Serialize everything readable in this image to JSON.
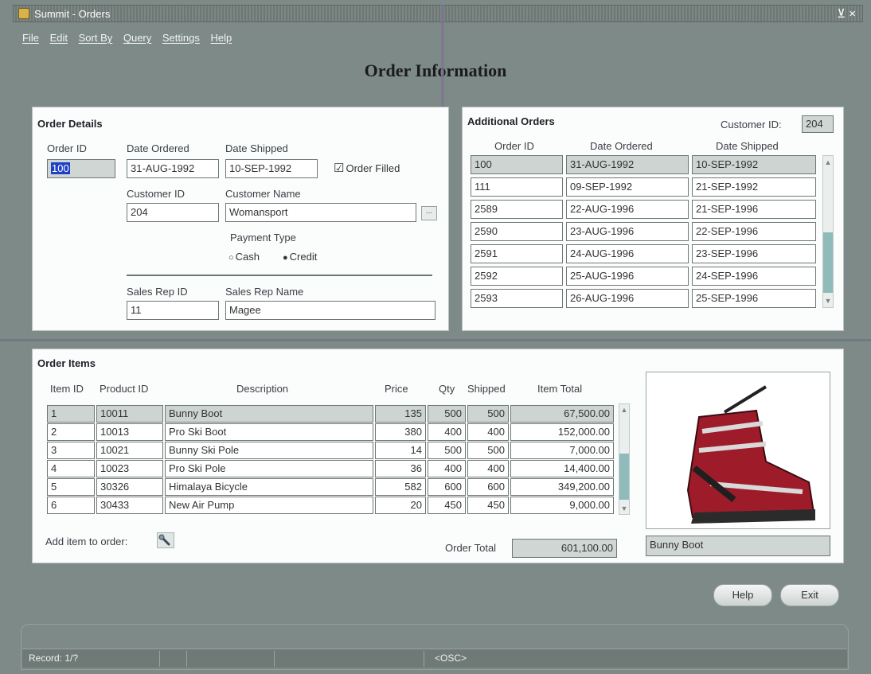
{
  "window": {
    "title": "Summit - Orders",
    "controls": "⊻ ×"
  },
  "menu": [
    "File",
    "Edit",
    "Sort By",
    "Query",
    "Settings",
    "Help"
  ],
  "page_title": "Order Information",
  "order_details": {
    "title": "Order Details",
    "order_id_label": "Order ID",
    "order_id": "100",
    "date_ordered_label": "Date Ordered",
    "date_ordered": "31-AUG-1992",
    "date_shipped_label": "Date Shipped",
    "date_shipped": "10-SEP-1992",
    "order_filled_label": "Order Filled",
    "order_filled_checked": true,
    "customer_id_label": "Customer ID",
    "customer_id": "204",
    "customer_name_label": "Customer Name",
    "customer_name": "Womansport",
    "lov_button": "...",
    "payment_type_label": "Payment Type",
    "payment_cash": "Cash",
    "payment_credit": "Credit",
    "payment_selected": "Credit",
    "sales_rep_id_label": "Sales Rep ID",
    "sales_rep_id": "11",
    "sales_rep_name_label": "Sales Rep Name",
    "sales_rep_name": "Magee"
  },
  "additional_orders": {
    "title": "Additional Orders",
    "customer_id_label": "Customer ID:",
    "customer_id": "204",
    "columns": [
      "Order ID",
      "Date Ordered",
      "Date Shipped"
    ],
    "rows": [
      [
        "100",
        "31-AUG-1992",
        "10-SEP-1992"
      ],
      [
        "111",
        "09-SEP-1992",
        "21-SEP-1992"
      ],
      [
        "2589",
        "22-AUG-1996",
        "21-SEP-1996"
      ],
      [
        "2590",
        "23-AUG-1996",
        "22-SEP-1996"
      ],
      [
        "2591",
        "24-AUG-1996",
        "23-SEP-1996"
      ],
      [
        "2592",
        "25-AUG-1996",
        "24-SEP-1996"
      ],
      [
        "2593",
        "26-AUG-1996",
        "25-SEP-1996"
      ]
    ]
  },
  "order_items": {
    "title": "Order Items",
    "columns": [
      "Item ID",
      "Product ID",
      "Description",
      "Price",
      "Qty",
      "Shipped",
      "Item Total"
    ],
    "rows": [
      [
        "1",
        "10011",
        "Bunny Boot",
        "135",
        "500",
        "500",
        "67,500.00"
      ],
      [
        "2",
        "10013",
        "Pro Ski Boot",
        "380",
        "400",
        "400",
        "152,000.00"
      ],
      [
        "3",
        "10021",
        "Bunny Ski Pole",
        "14",
        "500",
        "500",
        "7,000.00"
      ],
      [
        "4",
        "10023",
        "Pro Ski Pole",
        "36",
        "400",
        "400",
        "14,400.00"
      ],
      [
        "5",
        "30326",
        "Himalaya Bicycle",
        "582",
        "600",
        "600",
        "349,200.00"
      ],
      [
        "6",
        "30433",
        "New Air Pump",
        "20",
        "450",
        "450",
        "9,000.00"
      ]
    ],
    "add_item_label": "Add item to order:",
    "order_total_label": "Order Total",
    "order_total": "601,100.00",
    "product_image_caption": "Bunny Boot"
  },
  "buttons": {
    "help": "Help",
    "exit": "Exit"
  },
  "status": {
    "record": "Record: 1/?",
    "mode": "<OSC>"
  }
}
